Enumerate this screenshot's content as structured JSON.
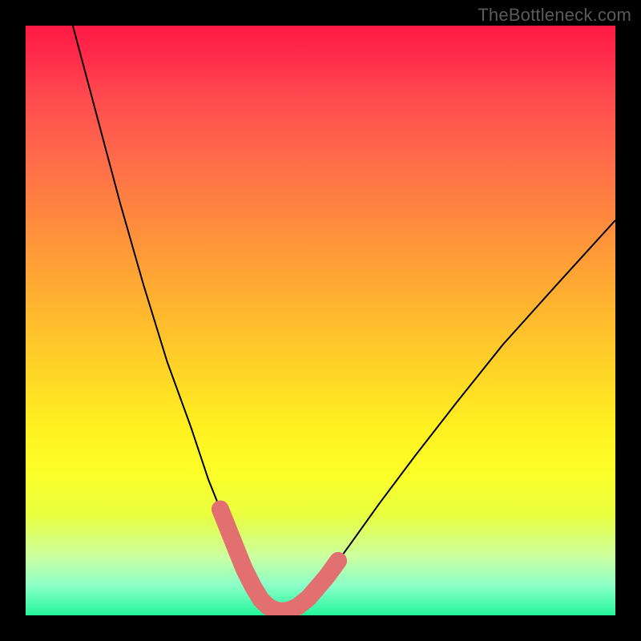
{
  "watermark": "TheBottleneck.com",
  "chart_data": {
    "type": "line",
    "title": "",
    "xlabel": "",
    "ylabel": "",
    "xlim": [
      0,
      100
    ],
    "ylim": [
      0,
      100
    ],
    "grid": false,
    "legend": false,
    "x": [
      8,
      12,
      16,
      20,
      24,
      28,
      31,
      33,
      35,
      37,
      38.5,
      40,
      41.5,
      43,
      44.5,
      46,
      48,
      51,
      55,
      60,
      66,
      73,
      81,
      90,
      100
    ],
    "values": [
      100,
      85,
      70,
      56,
      43,
      32,
      23,
      18,
      13,
      8,
      5,
      2.5,
      1.2,
      0.7,
      0.8,
      1.4,
      3,
      6.5,
      12,
      19,
      27,
      36,
      46,
      56,
      67
    ],
    "highlight_segments": [
      {
        "x_from": 33,
        "x_to": 38,
        "side": "left"
      },
      {
        "x_from": 38,
        "x_to": 48,
        "side": "bottom"
      },
      {
        "x_from": 48,
        "x_to": 53,
        "side": "right"
      }
    ],
    "gradient_stops": [
      {
        "pos": 0,
        "color": "#ff1a44"
      },
      {
        "pos": 12,
        "color": "#ff4a4f"
      },
      {
        "pos": 33,
        "color": "#ff8a3e"
      },
      {
        "pos": 57,
        "color": "#ffd028"
      },
      {
        "pos": 76,
        "color": "#fcff28"
      },
      {
        "pos": 90,
        "color": "#ccffa0"
      },
      {
        "pos": 100,
        "color": "#22f59a"
      }
    ]
  }
}
